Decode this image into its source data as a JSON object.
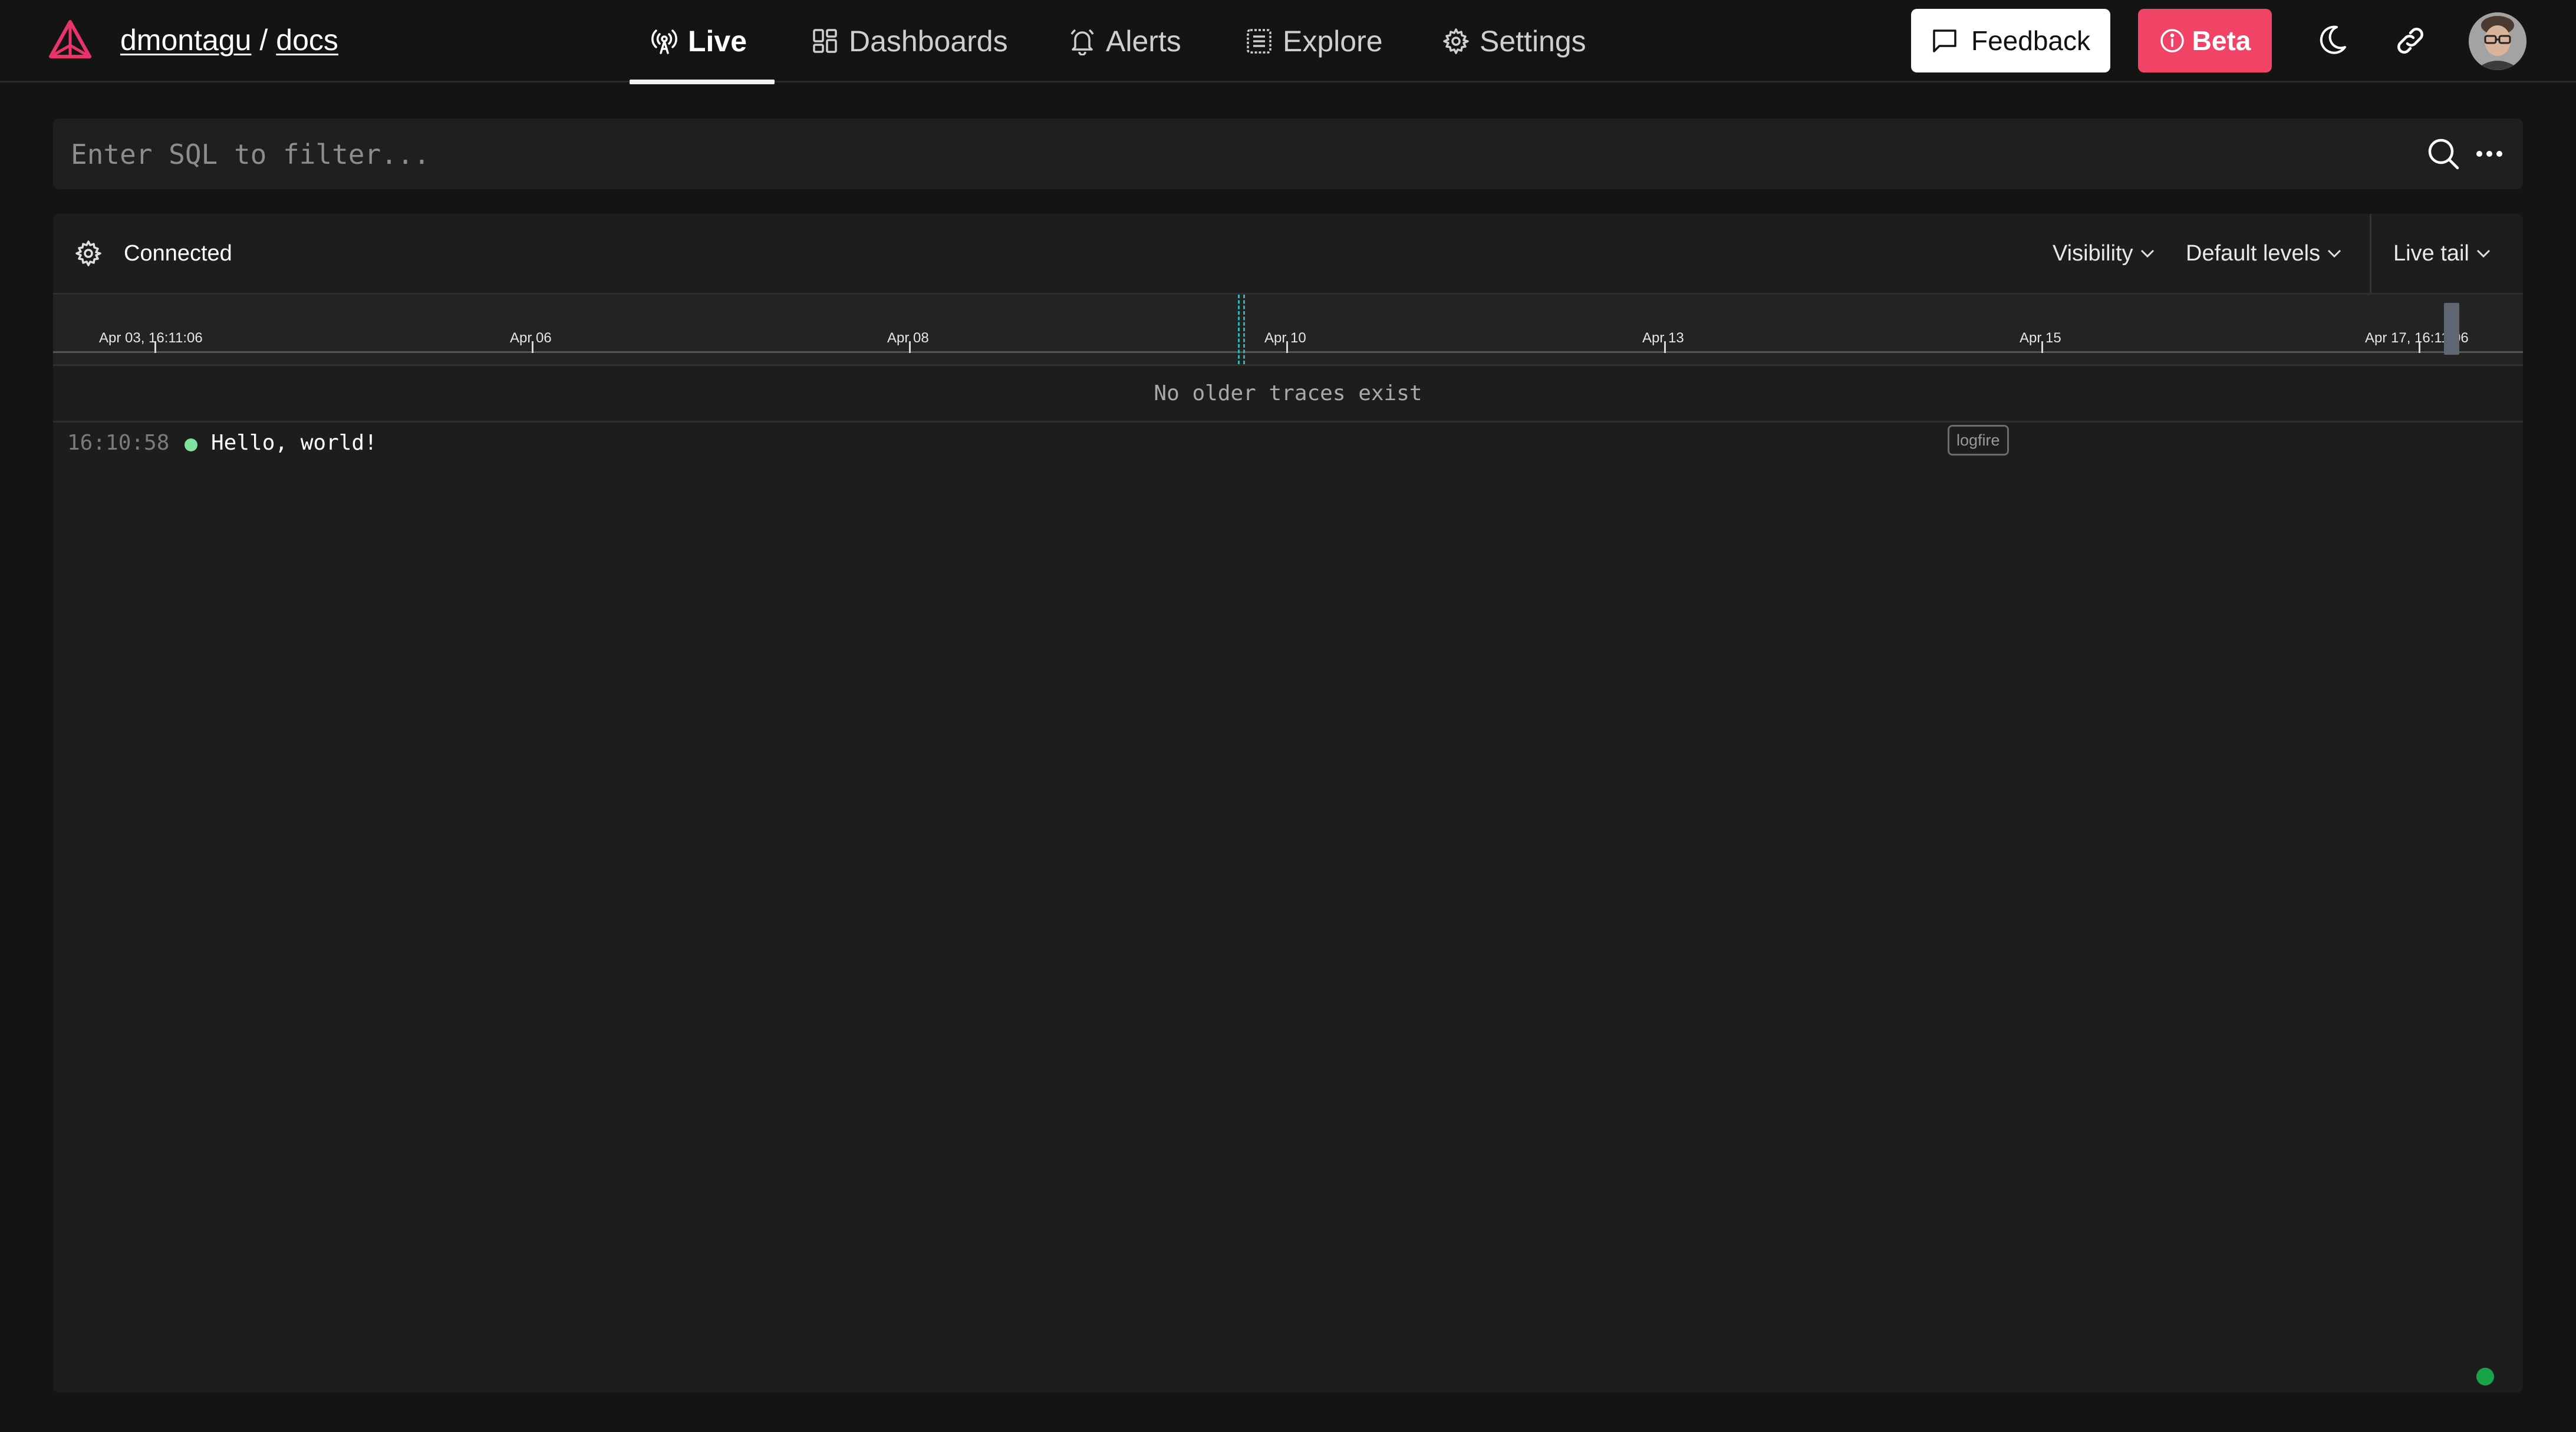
{
  "header": {
    "org": "dmontagu",
    "separator": "/",
    "project": "docs"
  },
  "nav": {
    "items": [
      {
        "label": "Live",
        "icon": "live-broadcast-icon",
        "active": true
      },
      {
        "label": "Dashboards",
        "icon": "dashboards-grid-icon",
        "active": false
      },
      {
        "label": "Alerts",
        "icon": "bell-icon",
        "active": false
      },
      {
        "label": "Explore",
        "icon": "explore-list-icon",
        "active": false
      },
      {
        "label": "Settings",
        "icon": "gear-icon",
        "active": false
      }
    ]
  },
  "actions": {
    "feedback_label": "Feedback",
    "beta_label": "Beta"
  },
  "filter": {
    "placeholder": "Enter SQL to filter..."
  },
  "panel": {
    "status": "Connected",
    "visibility_label": "Visibility",
    "levels_label": "Default levels",
    "live_tail_label": "Live tail"
  },
  "timeline": {
    "labels": [
      "Apr 03, 16:11:06",
      "Apr 06",
      "Apr 08",
      "Apr 10",
      "Apr 13",
      "Apr 15",
      "Apr 17, 16:11:06"
    ]
  },
  "traces": {
    "empty_notice": "No older traces exist",
    "rows": [
      {
        "time": "16:10:58",
        "level_color": "#7fe0a0",
        "message": "Hello, world!",
        "service": "logfire"
      }
    ]
  },
  "colors": {
    "background": "#141414",
    "panel": "#1d1d1d",
    "beta": "#f04366",
    "connected": "#19a44a",
    "marker": "#2fb3b3"
  }
}
